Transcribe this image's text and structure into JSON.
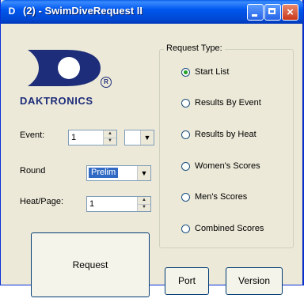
{
  "window": {
    "title": "(2) - SwimDiveRequest II",
    "app_icon": "daktronics-app-icon",
    "close_glyph": "×"
  },
  "logo": {
    "brand_text": "DAKTRONICS",
    "brand_color": "#1d2d7a",
    "registered_mark": "R"
  },
  "form": {
    "event": {
      "label": "Event:",
      "value": "1"
    },
    "round": {
      "label": "Round",
      "value": "Prelim"
    },
    "heat": {
      "label": "Heat/Page:",
      "value": "1"
    }
  },
  "request_type": {
    "title": "Request Type:",
    "options": [
      {
        "label": "Start List",
        "checked": true
      },
      {
        "label": "Results By Event",
        "checked": false
      },
      {
        "label": "Results by Heat",
        "checked": false
      },
      {
        "label": "Women's Scores",
        "checked": false
      },
      {
        "label": "Men's Scores",
        "checked": false
      },
      {
        "label": "Combined Scores",
        "checked": false
      }
    ]
  },
  "buttons": {
    "request": "Request",
    "port": "Port",
    "version": "Version"
  },
  "colors": {
    "titlebar": "#0058ee",
    "selection": "#316ac5",
    "window_bg": "#ece9d8"
  }
}
